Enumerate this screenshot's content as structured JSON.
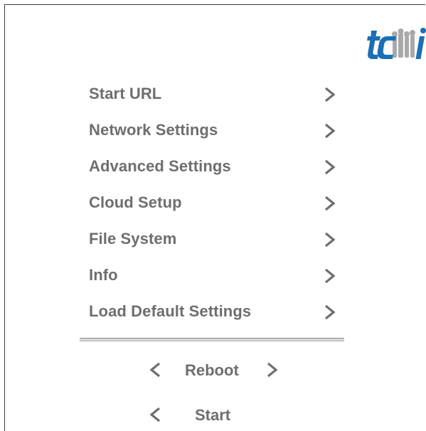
{
  "menu": {
    "items": [
      {
        "label": "Start URL"
      },
      {
        "label": "Network Settings"
      },
      {
        "label": "Advanced Settings"
      },
      {
        "label": "Cloud Setup"
      },
      {
        "label": "File System"
      },
      {
        "label": "Info"
      },
      {
        "label": "Load Default Settings"
      }
    ],
    "item_icon": "chevron-right-icon"
  },
  "footer": {
    "reboot_label": "Reboot",
    "start_label": "Start"
  },
  "logo": {
    "text": "tcmi"
  },
  "colors": {
    "text": "#6e6e6e",
    "logo_blue": "#1b6fb5",
    "logo_gray": "#a9a9a9",
    "border": "#3a3a3a"
  }
}
